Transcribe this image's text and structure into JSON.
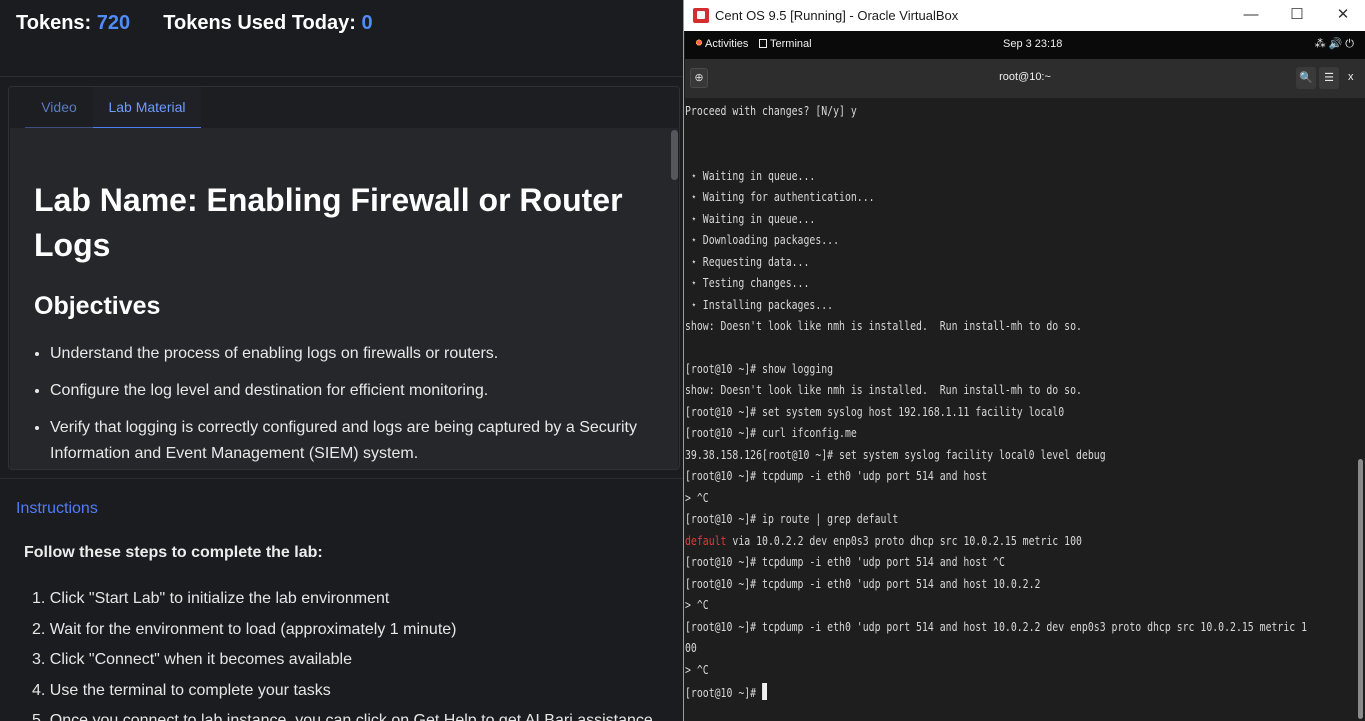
{
  "tokens": {
    "tokens_label": "Tokens:",
    "tokens_value": "720",
    "used_label": "Tokens Used Today:",
    "used_value": "0"
  },
  "tabs": [
    {
      "label": "Video"
    },
    {
      "label": "Lab Material"
    }
  ],
  "lab": {
    "title": "Lab Name: Enabling Firewall or Router Logs",
    "objectives_heading": "Objectives",
    "objectives": [
      "Understand the process of enabling logs on firewalls or routers.",
      "Configure the log level and destination for efficient monitoring.",
      "Verify that logging is correctly configured and logs are being captured by a Security Information and Event Management (SIEM) system."
    ]
  },
  "instructions": {
    "link_label": "Instructions",
    "lead": "Follow these steps to complete the lab:",
    "steps": [
      "1. Click \"Start Lab\" to initialize the lab environment",
      "2. Wait for the environment to load (approximately 1 minute)",
      "3. Click \"Connect\" when it becomes available",
      "4. Use the terminal to complete your tasks",
      "5. Once you connect to lab instance, you can click on Get Help to get AI Bari assistance"
    ]
  },
  "vbox": {
    "window_title": "Cent OS 9.5 [Running] - Oracle VirtualBox",
    "minimize_glyph": "—",
    "maximize_glyph": "☐",
    "close_glyph": "✕"
  },
  "gnome": {
    "activities": "Activities",
    "terminal_app": "Terminal",
    "clock": "Sep 3  23:18",
    "tray": "⁂🔊⏻"
  },
  "terminal": {
    "title": "root@10:~",
    "new_tab_glyph": "⊕",
    "search_glyph": "🔍",
    "menu_glyph": "☰",
    "close_glyph": "x",
    "lines": [
      "Proceed with changes? [N/y] y",
      "",
      "",
      " ⋆ Waiting in queue...",
      " ⋆ Waiting for authentication...",
      " ⋆ Waiting in queue...",
      " ⋆ Downloading packages...",
      " ⋆ Requesting data...",
      " ⋆ Testing changes...",
      " ⋆ Installing packages...",
      "show: Doesn't look like nmh is installed.  Run install-mh to do so.",
      "",
      "[root@10 ~]# show logging",
      "show: Doesn't look like nmh is installed.  Run install-mh to do so.",
      "[root@10 ~]# set system syslog host 192.168.1.11 facility local0",
      "[root@10 ~]# curl ifconfig.me",
      "39.38.158.126[root@10 ~]# set system syslog facility local0 level debug",
      "[root@10 ~]# tcpdump -i eth0 'udp port 514 and host",
      "> ^C",
      "[root@10 ~]# ip route | grep default",
      " via 10.0.2.2 dev enp0s3 proto dhcp src 10.0.2.15 metric 100",
      "[root@10 ~]# tcpdump -i eth0 'udp port 514 and host ^C",
      "[root@10 ~]# tcpdump -i eth0 'udp port 514 and host 10.0.2.2",
      "> ^C",
      "[root@10 ~]# tcpdump -i eth0 'udp port 514 and host 10.0.2.2 dev enp0s3 proto dhcp src 10.0.2.15 metric 1",
      "00",
      "> ^C",
      "[root@10 ~]# "
    ],
    "highlight_word": "default"
  },
  "colors": {
    "accent": "#4f7df5",
    "token_value": "#4f8cf7",
    "terminal_bg": "#1e1e1e",
    "keyword_red": "#e03a3a"
  }
}
